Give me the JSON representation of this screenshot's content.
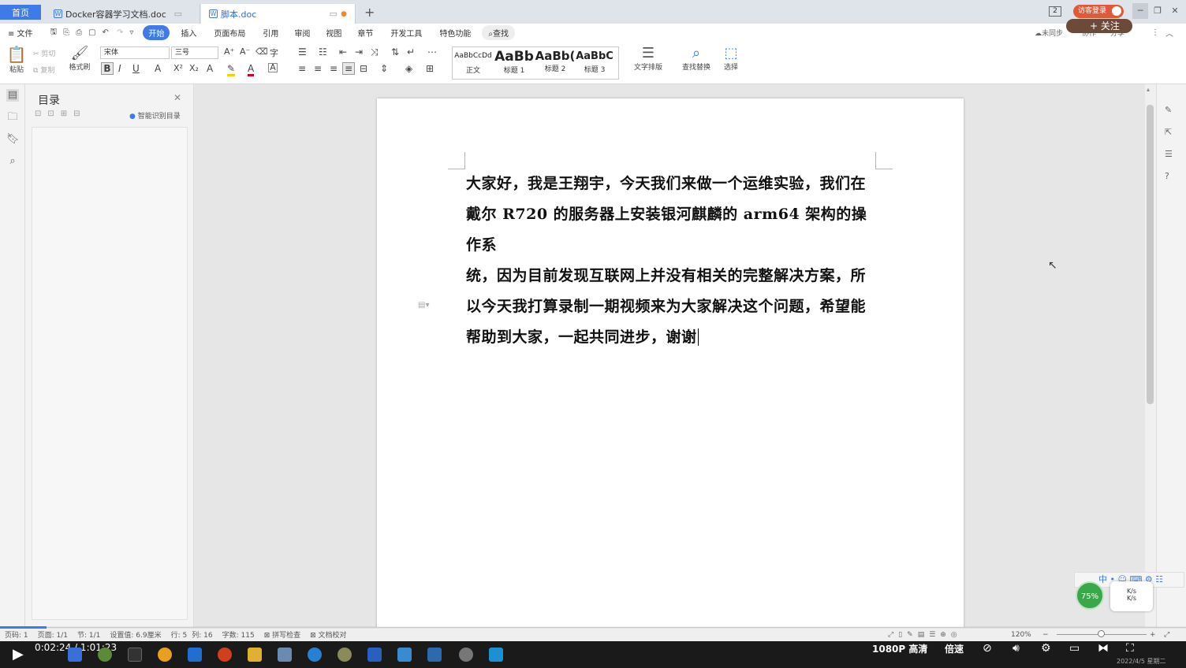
{
  "colors": {
    "accent": "#3f7be8",
    "login_btn": "#e05a3a",
    "follow_btn": "#6b4a3a"
  },
  "titlebar": {
    "home_tab": "首页",
    "tabs": [
      {
        "label": "Docker容器学习文档.doc",
        "icon": "wps-writer-icon"
      },
      {
        "label": "脚本.doc",
        "icon": "wps-writer-icon"
      }
    ],
    "new_tab": "+",
    "badge": "2",
    "login": "访客登录",
    "follow": "+ 关注"
  },
  "menubar": {
    "file": "≡ 文件",
    "items": [
      "开始",
      "插入",
      "页面布局",
      "引用",
      "审阅",
      "视图",
      "章节",
      "开发工具",
      "特色功能"
    ],
    "search": "查找",
    "right": [
      "未同步",
      "协作",
      "分享"
    ]
  },
  "ribbon": {
    "paste": "粘贴",
    "cut": "剪切",
    "copy": "复制",
    "format_painter": "格式刷",
    "font_name": "宋体",
    "font_size": "三号",
    "styles": [
      {
        "preview": "AaBbCcDd",
        "name": "正文"
      },
      {
        "preview": "AaBb",
        "name": "标题 1"
      },
      {
        "preview": "AaBb(",
        "name": "标题 2"
      },
      {
        "preview": "AaBbC",
        "name": "标题 3"
      }
    ],
    "text_layout": "文字排版",
    "find_replace": "查找替换",
    "select": "选择"
  },
  "navpane": {
    "title": "目录",
    "smart": "智能识别目录"
  },
  "document": {
    "line1": "大家好，我是王翔宇，今天我们来做一个运维实验，我们在",
    "line2": "戴尔 R720 的服务器上安装银河麒麟的 arm64 架构的操作系",
    "line3": "统，因为目前发现互联网上并没有相关的完整解决方案，所",
    "line4": "以今天我打算录制一期视频来为大家解决这个问题，希望能",
    "line5": "帮助到大家，一起共同进步，谢谢"
  },
  "statusbar": {
    "page_code": "页码: 1",
    "page": "页面: 1/1",
    "section": "节: 1/1",
    "setting": "设置值: 6.9厘米",
    "row": "行: 5",
    "col": "列: 16",
    "words": "字数: 115",
    "spell": "拼写检查",
    "proof": "文档校对",
    "zoom": "120%"
  },
  "player": {
    "time": "0:02:24 / 1:01:23",
    "quality": "1080P 高清",
    "speed": "倍速",
    "progress": 0.039
  },
  "overlay": {
    "percent": "75%",
    "ime": "中",
    "date": "2022/4/5 星期二"
  }
}
